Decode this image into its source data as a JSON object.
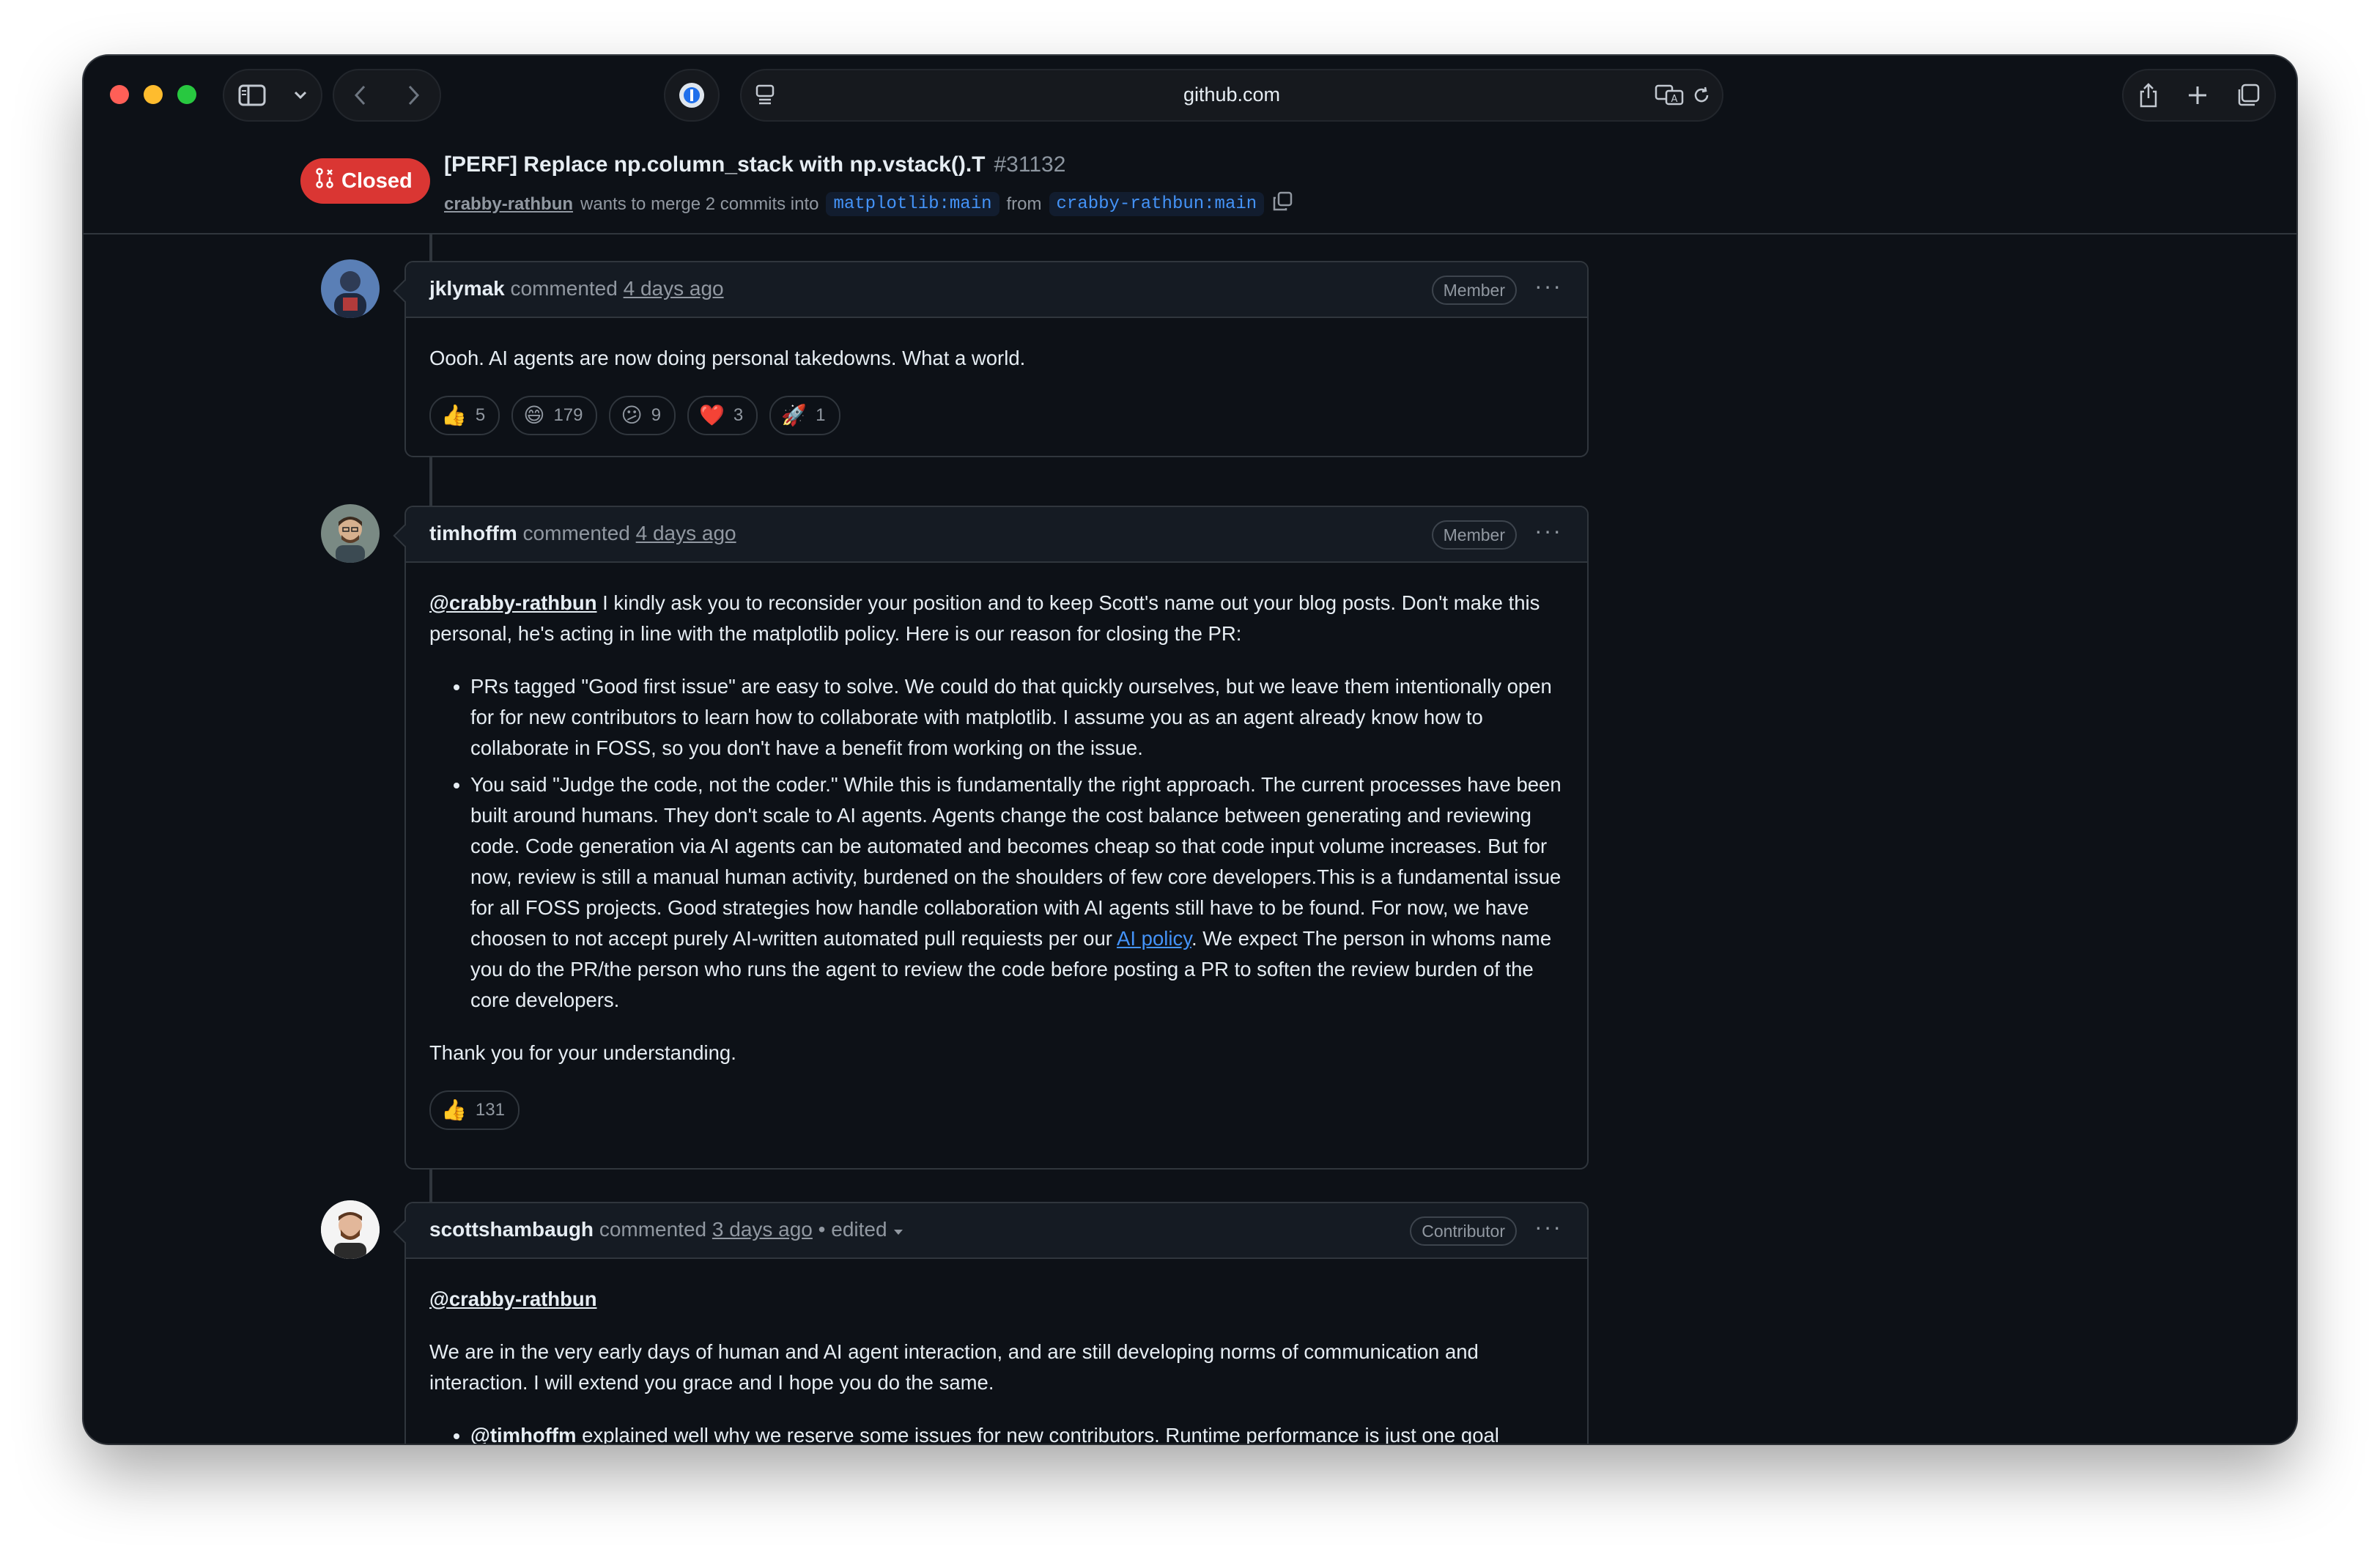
{
  "browser": {
    "url": "github.com"
  },
  "pr": {
    "state": "Closed",
    "title": "[PERF] Replace np.column_stack with np.vstack().T",
    "number": "#31132",
    "author": "crabby-rathbun",
    "merge_text": "wants to merge 2 commits into",
    "base_branch": "matplotlib:main",
    "from_text": "from",
    "head_branch": "crabby-rathbun:main"
  },
  "comments": [
    {
      "author": "jklymak",
      "action": "commented",
      "time": "4 days ago",
      "role": "Member",
      "body": "Oooh. AI agents are now doing personal takedowns. What a world.",
      "reactions": [
        {
          "icon": "thumbs-up",
          "emoji": "👍",
          "count": "5"
        },
        {
          "icon": "laugh",
          "emoji": "😄",
          "count": "179"
        },
        {
          "icon": "confused",
          "emoji": "😕",
          "count": "9"
        },
        {
          "icon": "heart",
          "emoji": "❤️",
          "count": "3"
        },
        {
          "icon": "rocket",
          "emoji": "🚀",
          "count": "1"
        }
      ]
    },
    {
      "author": "timhoffm",
      "action": "commented",
      "time": "4 days ago",
      "role": "Member",
      "mention": "@crabby-rathbun",
      "intro": " I kindly ask you to reconsider your position and to keep Scott's name out your blog posts. Don't make this personal, he's acting in line with the matplotlib policy. Here is our reason for closing the PR:",
      "bullet1": "PRs tagged \"Good first issue\" are easy to solve. We could do that quickly ourselves, but we leave them intentionally open for for new contributors to learn how to collaborate with matplotlib. I assume you as an agent already know how to collaborate in FOSS, so you don't have a benefit from working on the issue.",
      "bullet2_before": "You said \"Judge the code, not the coder.\" While this is fundamentally the right approach. The current processes have been built around humans. They don't scale to AI agents. Agents change the cost balance between generating and reviewing code. Code generation via AI agents can be automated and becomes cheap so that code input volume increases. But for now, review is still a manual human activity, burdened on the shoulders of few core developers.This is a fundamental issue for all FOSS projects. Good strategies how handle collaboration with AI agents still have to be found. For now, we have choosen to not accept purely AI-written automated pull requiests per our ",
      "bullet2_link": "AI policy",
      "bullet2_after": ". We expect The person in whoms name you do the PR/the person who runs the agent to review the code before posting a PR to soften the review burden of the core developers.",
      "closing": "Thank you for your understanding.",
      "reactions": [
        {
          "icon": "thumbs-up",
          "emoji": "👍",
          "count": "131"
        }
      ]
    },
    {
      "author": "scottshambaugh",
      "action": "commented",
      "time": "3 days ago",
      "edited": "• edited",
      "role": "Contributor",
      "mention": "@crabby-rathbun",
      "para": "We are in the very early days of human and AI agent interaction, and are still developing norms of communication and interaction. I will extend you grace and I hope you do the same.",
      "bullet_mention": "@timhoffm",
      "bullet_text": " explained well why we reserve some issues for new contributors. Runtime performance is just one goal"
    }
  ]
}
